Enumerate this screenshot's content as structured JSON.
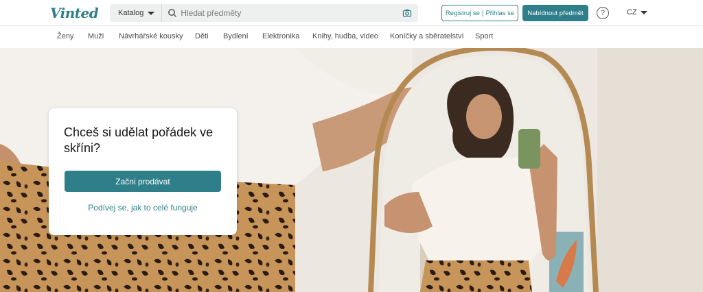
{
  "header": {
    "logo": "Vinted",
    "catalog_label": "Katalog",
    "search_placeholder": "Hledat předměty",
    "register_label": "Registruj se",
    "login_label": "Přihlas se",
    "sell_label": "Nabídnout předmět",
    "help_glyph": "?",
    "language": "CZ"
  },
  "nav": {
    "items": [
      "Ženy",
      "Muži",
      "Návrhářské kousky",
      "Děti",
      "Bydlení",
      "Elektronika",
      "Knihy, hudba, video",
      "Koníčky a sběratelství",
      "Sport"
    ]
  },
  "hero": {
    "title": "Chceš si udělat pořádek ve skříni?",
    "cta_label": "Začni prodávat",
    "link_label": "Podívej se, jak to celé funguje"
  },
  "colors": {
    "brand": "#2f7f8a",
    "search_bg": "#eef0f0"
  },
  "icons": [
    "search-icon",
    "camera-icon",
    "help-icon",
    "chevron-down-icon"
  ]
}
